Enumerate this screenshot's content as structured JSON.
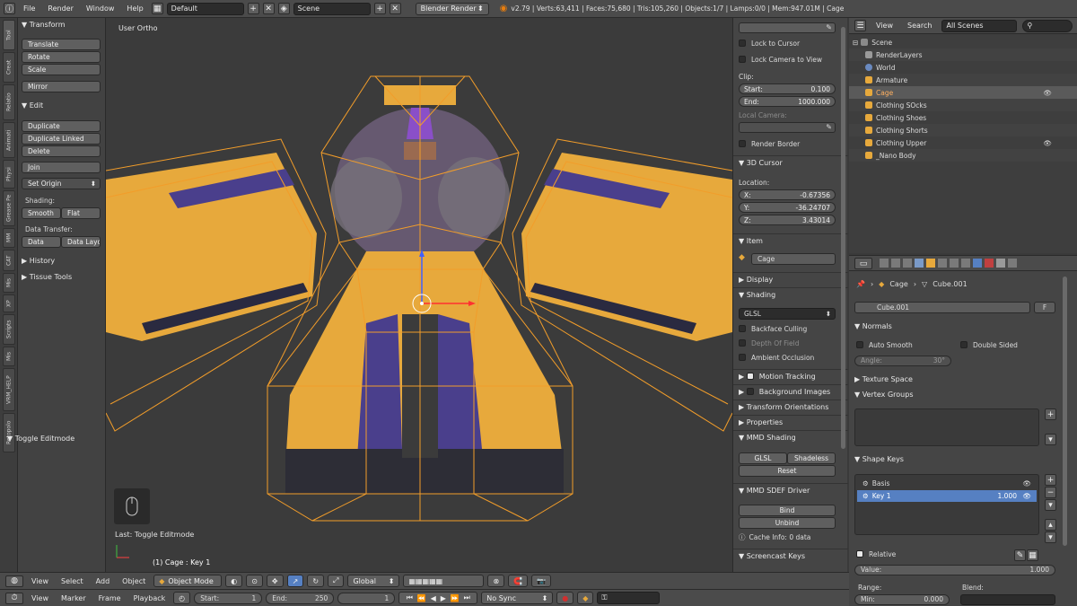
{
  "topbar": {
    "menus": [
      "File",
      "Render",
      "Window",
      "Help"
    ],
    "screen_layout": "Default",
    "scene": "Scene",
    "render_engine": "Blender Render",
    "stats": "v2.79 | Verts:63,411 | Faces:75,680 | Tris:105,260 | Objects:1/7 | Lamps:0/0 | Mem:947.01M | Cage"
  },
  "tabs": [
    "Tool",
    "Creat",
    "Relatio",
    "Animati",
    "Physi",
    "Grease Pe",
    "MM",
    "CAT",
    "Mis",
    "XP",
    "Scripts",
    "Mis",
    "VRM_HELP",
    "Retopolo"
  ],
  "toolshelf": {
    "transform_header": "Transform",
    "translate": "Translate",
    "rotate": "Rotate",
    "scale": "Scale",
    "mirror": "Mirror",
    "edit_header": "Edit",
    "duplicate": "Duplicate",
    "duplicate_linked": "Duplicate Linked",
    "delete": "Delete",
    "join": "Join",
    "set_origin": "Set Origin",
    "shading_label": "Shading:",
    "smooth": "Smooth",
    "flat": "Flat",
    "data_transfer_label": "Data Transfer:",
    "data": "Data",
    "data_layout": "Data Layo",
    "history": "History",
    "tissue_tools": "Tissue Tools",
    "last_op_header": "Toggle Editmode"
  },
  "viewport": {
    "view_label": "User Ortho",
    "last_op": "Last: Toggle Editmode",
    "object_info": "(1) Cage : Key 1"
  },
  "npanel": {
    "lock_to_cursor": "Lock to Cursor",
    "lock_camera": "Lock Camera to View",
    "clip_label": "Clip:",
    "clip_start_label": "Start:",
    "clip_start": "0.100",
    "clip_end_label": "End:",
    "clip_end": "1000.000",
    "local_camera_label": "Local Camera:",
    "render_border": "Render Border",
    "cursor_header": "3D Cursor",
    "location_label": "Location:",
    "x_label": "X:",
    "x": "-0.67356",
    "y_label": "Y:",
    "y": "-36.24707",
    "z_label": "Z:",
    "z": "3.43014",
    "item_header": "Item",
    "item_name": "Cage",
    "display_header": "Display",
    "shading_header": "Shading",
    "shading_mode": "GLSL",
    "backface_culling": "Backface Culling",
    "depth_of_field": "Depth Of Field",
    "ambient_occlusion": "Ambient Occlusion",
    "motion_tracking": "Motion Tracking",
    "background_images": "Background Images",
    "transform_orientations": "Transform Orientations",
    "properties": "Properties",
    "mmd_shading": "MMD Shading",
    "glsl_btn": "GLSL",
    "shadeless_btn": "Shadeless",
    "reset_btn": "Reset",
    "mmd_sdef": "MMD SDEF Driver",
    "bind_btn": "Bind",
    "unbind_btn": "Unbind",
    "cache_info": "Cache Info: 0 data",
    "screencast_keys": "Screencast Keys"
  },
  "outliner": {
    "view_menu": "View",
    "search_menu": "Search",
    "filter": "All Scenes",
    "rows": [
      {
        "name": "Scene",
        "indent": 0
      },
      {
        "name": "RenderLayers",
        "indent": 1
      },
      {
        "name": "World",
        "indent": 1
      },
      {
        "name": "Armature",
        "indent": 1
      },
      {
        "name": "Cage",
        "indent": 1
      },
      {
        "name": "Clothing SOcks",
        "indent": 1
      },
      {
        "name": "Clothing Shoes",
        "indent": 1
      },
      {
        "name": "Clothing Shorts",
        "indent": 1
      },
      {
        "name": "Clothing Upper",
        "indent": 1
      },
      {
        "name": "_Nano Body",
        "indent": 1
      }
    ]
  },
  "properties": {
    "breadcrumb_object": "Cage",
    "breadcrumb_data": "Cube.001",
    "mesh_name": "Cube.001",
    "fake_user": "F",
    "normals_header": "Normals",
    "auto_smooth": "Auto Smooth",
    "double_sided": "Double Sided",
    "angle_label": "Angle:",
    "angle": "30°",
    "texture_space": "Texture Space",
    "vertex_groups": "Vertex Groups",
    "shape_keys": "Shape Keys",
    "basis": "Basis",
    "key1": "Key 1",
    "key1_value": "1.000",
    "relative": "Relative",
    "value_label": "Value:",
    "value": "1.000",
    "range_label": "Range:",
    "blend_label": "Blend:",
    "min_label": "Min:",
    "min": "0.000"
  },
  "bottom1": {
    "view": "View",
    "select": "Select",
    "add": "Add",
    "object": "Object",
    "mode": "Object Mode",
    "orientation": "Global"
  },
  "bottom2": {
    "view": "View",
    "marker": "Marker",
    "frame": "Frame",
    "playback": "Playback",
    "start_label": "Start:",
    "start": "1",
    "end_label": "End:",
    "end": "250",
    "current": "1",
    "sync": "No Sync"
  },
  "colors": {
    "accent_selected": "#5680c2",
    "wire_selected": "#f29d2a",
    "object_yellow": "#e7a93c",
    "object_purple": "#4a3f8c"
  }
}
